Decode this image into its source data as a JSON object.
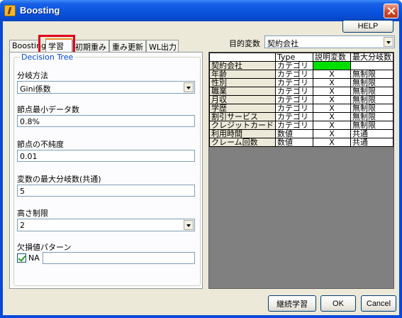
{
  "window": {
    "title": "Boosting",
    "colors": {
      "titlebar": "#0a52dc",
      "client": "#ece9d8",
      "highlight": "#e0001b",
      "green_cell": "#00e000"
    }
  },
  "header": {
    "help_label": "HELP",
    "target_label": "目的変数",
    "target_value": "契約会社"
  },
  "tabs": [
    {
      "label": "Boosting"
    },
    {
      "label": "学習"
    },
    {
      "label": "初期重み"
    },
    {
      "label": "重み更新"
    },
    {
      "label": "WL出力"
    }
  ],
  "settings": {
    "group_title": "Decision Tree",
    "split_method": {
      "label": "分岐方法",
      "value": "Gini係数"
    },
    "min_node_data": {
      "label": "節点最小データ数",
      "value": "0.8%"
    },
    "node_impurity": {
      "label": "節点の不純度",
      "value": "0.01"
    },
    "max_splits": {
      "label": "変数の最大分岐数(共通)",
      "value": "5"
    },
    "height_limit": {
      "label": "高さ制限",
      "value": "2"
    },
    "missing_pattern": {
      "label": "欠損値パターン",
      "checkbox_label": "NA",
      "checked": true,
      "value": ""
    }
  },
  "variables_table": {
    "columns": [
      "",
      "Type",
      "説明変数",
      "最大分岐数"
    ],
    "rows": [
      {
        "name": "契約会社",
        "type": "カテゴリ",
        "explanatory": "",
        "max_splits": ""
      },
      {
        "name": "年齢",
        "type": "カテゴリ",
        "explanatory": "X",
        "max_splits": "無制限"
      },
      {
        "name": "性別",
        "type": "カテゴリ",
        "explanatory": "X",
        "max_splits": "無制限"
      },
      {
        "name": "職業",
        "type": "カテゴリ",
        "explanatory": "X",
        "max_splits": "無制限"
      },
      {
        "name": "月収",
        "type": "カテゴリ",
        "explanatory": "X",
        "max_splits": "無制限"
      },
      {
        "name": "学歴",
        "type": "カテゴリ",
        "explanatory": "X",
        "max_splits": "無制限"
      },
      {
        "name": "割引サービス",
        "type": "カテゴリ",
        "explanatory": "X",
        "max_splits": "無制限"
      },
      {
        "name": "クレジットカード",
        "type": "カテゴリ",
        "explanatory": "X",
        "max_splits": "無制限"
      },
      {
        "name": "利用時間",
        "type": "数値",
        "explanatory": "X",
        "max_splits": "共通"
      },
      {
        "name": "クレーム回数",
        "type": "数値",
        "explanatory": "X",
        "max_splits": "共通"
      }
    ]
  },
  "footer": {
    "continue_label": "継続学習",
    "ok_label": "OK",
    "cancel_label": "Cancel"
  }
}
